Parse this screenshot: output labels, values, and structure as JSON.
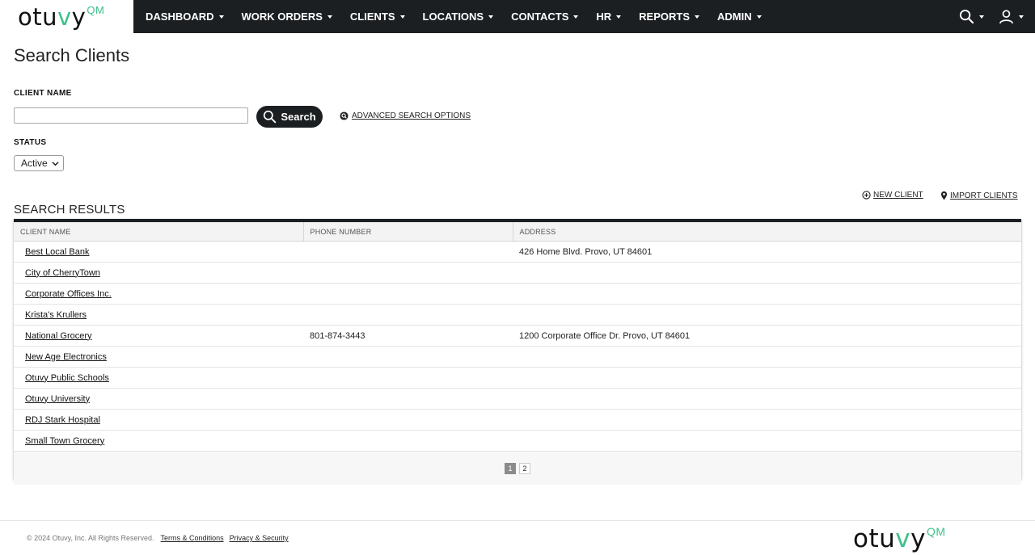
{
  "brand": {
    "name_prefix": "otu",
    "name_v": "v",
    "name_suffix": "y",
    "suffix": "QM"
  },
  "nav": {
    "items": [
      {
        "label": "DASHBOARD"
      },
      {
        "label": "WORK ORDERS"
      },
      {
        "label": "CLIENTS"
      },
      {
        "label": "LOCATIONS"
      },
      {
        "label": "CONTACTS"
      },
      {
        "label": "HR"
      },
      {
        "label": "REPORTS"
      },
      {
        "label": "ADMIN"
      }
    ],
    "icons": {
      "search": "search-icon",
      "user": "user-icon"
    }
  },
  "page": {
    "title": "Search Clients"
  },
  "search": {
    "client_name_label": "CLIENT NAME",
    "client_name_value": "",
    "button_label": "Search",
    "advanced_link": "ADVANCED SEARCH OPTIONS",
    "status_label": "STATUS",
    "status_value": "Active"
  },
  "actions": {
    "new_client": "NEW CLIENT",
    "import_clients": "IMPORT CLIENTS"
  },
  "results": {
    "title": "SEARCH RESULTS",
    "columns": [
      "CLIENT NAME",
      "PHONE NUMBER",
      "ADDRESS"
    ],
    "rows": [
      {
        "name": "Best Local Bank",
        "phone": "",
        "address": "426 Home Blvd. Provo, UT 84601"
      },
      {
        "name": "City of CherryTown",
        "phone": "",
        "address": ""
      },
      {
        "name": "Corporate Offices Inc.",
        "phone": "",
        "address": ""
      },
      {
        "name": "Krista's Krullers",
        "phone": "",
        "address": ""
      },
      {
        "name": "National Grocery",
        "phone": "801-874-3443",
        "address": "1200 Corporate Office Dr. Provo, UT 84601"
      },
      {
        "name": "New Age Electronics",
        "phone": "",
        "address": ""
      },
      {
        "name": "Otuvy Public Schools",
        "phone": "",
        "address": ""
      },
      {
        "name": "Otuvy University",
        "phone": "",
        "address": ""
      },
      {
        "name": "RDJ Stark Hospital",
        "phone": "",
        "address": ""
      },
      {
        "name": "Small Town Grocery",
        "phone": "",
        "address": ""
      }
    ],
    "pagination": {
      "pages": [
        "1",
        "2"
      ],
      "current": "1"
    }
  },
  "footer": {
    "copyright": "© 2024 Otuvy, Inc. All Rights Reserved.",
    "terms": "Terms & Conditions",
    "privacy": "Privacy & Security"
  },
  "colors": {
    "nav_bg": "#1c1f22",
    "brand_green": "#3ec08a",
    "active_page": "#8b8b8b"
  }
}
